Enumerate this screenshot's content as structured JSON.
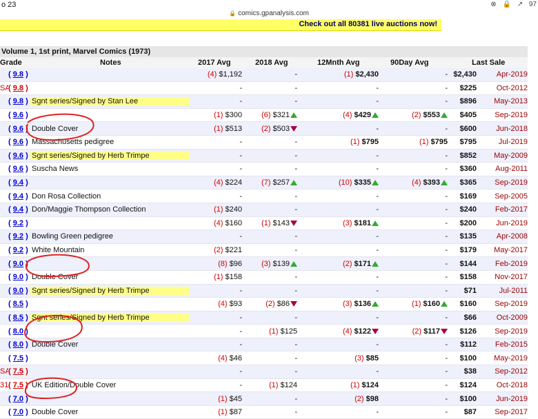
{
  "status": {
    "time": "o 23",
    "icons": [
      "⊗",
      "🔒",
      "↗",
      "97"
    ]
  },
  "url": "comics.gpanalysis.com",
  "banner": "Check out all 80381 live auctions now!",
  "volume_title": "Volume 1, 1st print, Marvel Comics (1973)",
  "headers": {
    "grade": "Grade",
    "notes": "Notes",
    "y2017": "2017 Avg",
    "y2018": "2018 Avg",
    "m12": "12Mnth Avg",
    "d90": "90Day Avg",
    "last": "Last Sale"
  },
  "rows": [
    {
      "pre": "",
      "grade": "9.8",
      "gc": "b",
      "note": "",
      "hl": false,
      "a": "(4)",
      "av": "$1,192",
      "ab": false,
      "b": "",
      "bv": "-",
      "bb": false,
      "bt": "",
      "c": "(1)",
      "cv": "$2,430",
      "cb": true,
      "ct": "",
      "d": "",
      "dv": "-",
      "db": false,
      "dt": "",
      "price": "$2,430",
      "date": "Apr-2019"
    },
    {
      "pre": "SA",
      "grade": "9.8",
      "gc": "r",
      "note": "",
      "hl": false,
      "a": "",
      "av": "-",
      "ab": false,
      "b": "",
      "bv": "-",
      "bb": false,
      "bt": "",
      "c": "",
      "cv": "-",
      "cb": false,
      "ct": "",
      "d": "",
      "dv": "-",
      "db": false,
      "dt": "",
      "price": "$225",
      "date": "Oct-2012"
    },
    {
      "pre": "",
      "grade": "9.8",
      "gc": "b",
      "note": "Sgnt series/Signed by Stan Lee",
      "hl": true,
      "a": "",
      "av": "-",
      "ab": false,
      "b": "",
      "bv": "-",
      "bb": false,
      "bt": "",
      "c": "",
      "cv": "-",
      "cb": false,
      "ct": "",
      "d": "",
      "dv": "-",
      "db": false,
      "dt": "",
      "price": "$896",
      "date": "May-2013"
    },
    {
      "pre": "",
      "grade": "9.6",
      "gc": "b",
      "note": "",
      "hl": false,
      "a": "(1)",
      "av": "$300",
      "ab": false,
      "b": "(6)",
      "bv": "$321",
      "bb": false,
      "bt": "up",
      "c": "(4)",
      "cv": "$429",
      "cb": true,
      "ct": "up",
      "d": "(2)",
      "dv": "$553",
      "db": true,
      "dt": "up",
      "price": "$405",
      "date": "Sep-2019"
    },
    {
      "pre": "",
      "grade": "9.6",
      "gc": "b",
      "note": "Double Cover",
      "hl": false,
      "a": "(1)",
      "av": "$513",
      "ab": false,
      "b": "(2)",
      "bv": "$503",
      "bb": false,
      "bt": "down",
      "c": "",
      "cv": "-",
      "cb": false,
      "ct": "",
      "d": "",
      "dv": "-",
      "db": false,
      "dt": "",
      "price": "$600",
      "date": "Jun-2018"
    },
    {
      "pre": "",
      "grade": "9.6",
      "gc": "b",
      "note": "Massachusetts pedigree",
      "hl": false,
      "a": "",
      "av": "-",
      "ab": false,
      "b": "",
      "bv": "-",
      "bb": false,
      "bt": "",
      "c": "(1)",
      "cv": "$795",
      "cb": true,
      "ct": "",
      "d": "(1)",
      "dv": "$795",
      "db": true,
      "dt": "",
      "price": "$795",
      "date": "Jul-2019"
    },
    {
      "pre": "",
      "grade": "9.6",
      "gc": "b",
      "note": "Sgnt series/Signed by Herb Trimpe",
      "hl": true,
      "a": "",
      "av": "-",
      "ab": false,
      "b": "",
      "bv": "-",
      "bb": false,
      "bt": "",
      "c": "",
      "cv": "-",
      "cb": false,
      "ct": "",
      "d": "",
      "dv": "-",
      "db": false,
      "dt": "",
      "price": "$852",
      "date": "May-2009"
    },
    {
      "pre": "",
      "grade": "9.6",
      "gc": "b",
      "note": "Suscha News",
      "hl": false,
      "a": "",
      "av": "-",
      "ab": false,
      "b": "",
      "bv": "-",
      "bb": false,
      "bt": "",
      "c": "",
      "cv": "-",
      "cb": false,
      "ct": "",
      "d": "",
      "dv": "-",
      "db": false,
      "dt": "",
      "price": "$360",
      "date": "Aug-2011"
    },
    {
      "pre": "",
      "grade": "9.4",
      "gc": "b",
      "note": "",
      "hl": false,
      "a": "(4)",
      "av": "$224",
      "ab": false,
      "b": "(7)",
      "bv": "$257",
      "bb": false,
      "bt": "up",
      "c": "(10)",
      "cv": "$335",
      "cb": true,
      "ct": "up",
      "d": "(4)",
      "dv": "$393",
      "db": true,
      "dt": "up",
      "price": "$365",
      "date": "Sep-2019"
    },
    {
      "pre": "",
      "grade": "9.4",
      "gc": "b",
      "note": "Don Rosa Collection",
      "hl": false,
      "a": "",
      "av": "-",
      "ab": false,
      "b": "",
      "bv": "-",
      "bb": false,
      "bt": "",
      "c": "",
      "cv": "-",
      "cb": false,
      "ct": "",
      "d": "",
      "dv": "-",
      "db": false,
      "dt": "",
      "price": "$169",
      "date": "Sep-2005"
    },
    {
      "pre": "",
      "grade": "9.4",
      "gc": "b",
      "note": "Don/Maggie Thompson Collection",
      "hl": false,
      "a": "(1)",
      "av": "$240",
      "ab": false,
      "b": "",
      "bv": "-",
      "bb": false,
      "bt": "",
      "c": "",
      "cv": "-",
      "cb": false,
      "ct": "",
      "d": "",
      "dv": "-",
      "db": false,
      "dt": "",
      "price": "$240",
      "date": "Feb-2017"
    },
    {
      "pre": "",
      "grade": "9.2",
      "gc": "b",
      "note": "",
      "hl": false,
      "a": "(4)",
      "av": "$160",
      "ab": false,
      "b": "(1)",
      "bv": "$143",
      "bb": false,
      "bt": "down",
      "c": "(3)",
      "cv": "$181",
      "cb": true,
      "ct": "up",
      "d": "",
      "dv": "-",
      "db": false,
      "dt": "",
      "price": "$200",
      "date": "Jun-2019"
    },
    {
      "pre": "",
      "grade": "9.2",
      "gc": "b",
      "note": "Bowling Green pedigree",
      "hl": false,
      "a": "",
      "av": "-",
      "ab": false,
      "b": "",
      "bv": "-",
      "bb": false,
      "bt": "",
      "c": "",
      "cv": "-",
      "cb": false,
      "ct": "",
      "d": "",
      "dv": "-",
      "db": false,
      "dt": "",
      "price": "$135",
      "date": "Apr-2008"
    },
    {
      "pre": "",
      "grade": "9.2",
      "gc": "b",
      "note": "White Mountain",
      "hl": false,
      "a": "(2)",
      "av": "$221",
      "ab": false,
      "b": "",
      "bv": "-",
      "bb": false,
      "bt": "",
      "c": "",
      "cv": "-",
      "cb": false,
      "ct": "",
      "d": "",
      "dv": "-",
      "db": false,
      "dt": "",
      "price": "$179",
      "date": "May-2017"
    },
    {
      "pre": "",
      "grade": "9.0",
      "gc": "b",
      "note": "",
      "hl": false,
      "a": "(8)",
      "av": "$96",
      "ab": false,
      "b": "(3)",
      "bv": "$139",
      "bb": false,
      "bt": "up",
      "c": "(2)",
      "cv": "$171",
      "cb": true,
      "ct": "up",
      "d": "",
      "dv": "-",
      "db": false,
      "dt": "",
      "price": "$144",
      "date": "Feb-2019"
    },
    {
      "pre": "",
      "grade": "9.0",
      "gc": "b",
      "note": "Double Cover",
      "hl": false,
      "a": "(1)",
      "av": "$158",
      "ab": false,
      "b": "",
      "bv": "-",
      "bb": false,
      "bt": "",
      "c": "",
      "cv": "-",
      "cb": false,
      "ct": "",
      "d": "",
      "dv": "-",
      "db": false,
      "dt": "",
      "price": "$158",
      "date": "Nov-2017"
    },
    {
      "pre": "",
      "grade": "9.0",
      "gc": "b",
      "note": "Sgnt series/Signed by Herb Trimpe",
      "hl": true,
      "a": "",
      "av": "-",
      "ab": false,
      "b": "",
      "bv": "-",
      "bb": false,
      "bt": "",
      "c": "",
      "cv": "-",
      "cb": false,
      "ct": "",
      "d": "",
      "dv": "-",
      "db": false,
      "dt": "",
      "price": "$71",
      "date": "Jul-2011"
    },
    {
      "pre": "",
      "grade": "8.5",
      "gc": "b",
      "note": "",
      "hl": false,
      "a": "(4)",
      "av": "$93",
      "ab": false,
      "b": "(2)",
      "bv": "$86",
      "bb": false,
      "bt": "down",
      "c": "(3)",
      "cv": "$136",
      "cb": true,
      "ct": "up",
      "d": "(1)",
      "dv": "$160",
      "db": true,
      "dt": "up",
      "price": "$160",
      "date": "Sep-2019"
    },
    {
      "pre": "",
      "grade": "8.5",
      "gc": "b",
      "note": "Sgnt series/Signed by Herb Trimpe",
      "hl": true,
      "a": "",
      "av": "-",
      "ab": false,
      "b": "",
      "bv": "-",
      "bb": false,
      "bt": "",
      "c": "",
      "cv": "-",
      "cb": false,
      "ct": "",
      "d": "",
      "dv": "-",
      "db": false,
      "dt": "",
      "price": "$66",
      "date": "Oct-2009"
    },
    {
      "pre": "",
      "grade": "8.0",
      "gc": "b",
      "note": "",
      "hl": false,
      "a": "",
      "av": "-",
      "ab": false,
      "b": "(1)",
      "bv": "$125",
      "bb": false,
      "bt": "",
      "c": "(4)",
      "cv": "$122",
      "cb": true,
      "ct": "down",
      "d": "(2)",
      "dv": "$117",
      "db": true,
      "dt": "down",
      "price": "$126",
      "date": "Sep-2019"
    },
    {
      "pre": "",
      "grade": "8.0",
      "gc": "b",
      "note": "Double Cover",
      "hl": false,
      "a": "",
      "av": "-",
      "ab": false,
      "b": "",
      "bv": "-",
      "bb": false,
      "bt": "",
      "c": "",
      "cv": "-",
      "cb": false,
      "ct": "",
      "d": "",
      "dv": "-",
      "db": false,
      "dt": "",
      "price": "$112",
      "date": "Feb-2015"
    },
    {
      "pre": "",
      "grade": "7.5",
      "gc": "b",
      "note": "",
      "hl": false,
      "a": "(4)",
      "av": "$46",
      "ab": false,
      "b": "",
      "bv": "-",
      "bb": false,
      "bt": "",
      "c": "(3)",
      "cv": "$85",
      "cb": true,
      "ct": "",
      "d": "",
      "dv": "-",
      "db": false,
      "dt": "",
      "price": "$100",
      "date": "May-2019"
    },
    {
      "pre": "SA",
      "grade": "7.5",
      "gc": "r",
      "note": "",
      "hl": false,
      "a": "",
      "av": "-",
      "ab": false,
      "b": "",
      "bv": "-",
      "bb": false,
      "bt": "",
      "c": "",
      "cv": "-",
      "cb": false,
      "ct": "",
      "d": "",
      "dv": "-",
      "db": false,
      "dt": "",
      "price": "$38",
      "date": "Sep-2012"
    },
    {
      "pre": "31",
      "grade": "7.5",
      "gc": "r",
      "note": "UK Edition/Double Cover",
      "hl": false,
      "a": "",
      "av": "-",
      "ab": false,
      "b": "(1)",
      "bv": "$124",
      "bb": false,
      "bt": "",
      "c": "(1)",
      "cv": "$124",
      "cb": true,
      "ct": "",
      "d": "",
      "dv": "-",
      "db": false,
      "dt": "",
      "price": "$124",
      "date": "Oct-2018"
    },
    {
      "pre": "",
      "grade": "7.0",
      "gc": "b",
      "note": "",
      "hl": false,
      "a": "(1)",
      "av": "$45",
      "ab": false,
      "b": "",
      "bv": "-",
      "bb": false,
      "bt": "",
      "c": "(2)",
      "cv": "$98",
      "cb": true,
      "ct": "",
      "d": "",
      "dv": "-",
      "db": false,
      "dt": "",
      "price": "$100",
      "date": "Jun-2019"
    },
    {
      "pre": "",
      "grade": "7.0",
      "gc": "b",
      "note": "Double Cover",
      "hl": false,
      "a": "(1)",
      "av": "$87",
      "ab": false,
      "b": "",
      "bv": "-",
      "bb": false,
      "bt": "",
      "c": "",
      "cv": "-",
      "cb": false,
      "ct": "",
      "d": "",
      "dv": "-",
      "db": false,
      "dt": "",
      "price": "$87",
      "date": "Sep-2017"
    }
  ]
}
